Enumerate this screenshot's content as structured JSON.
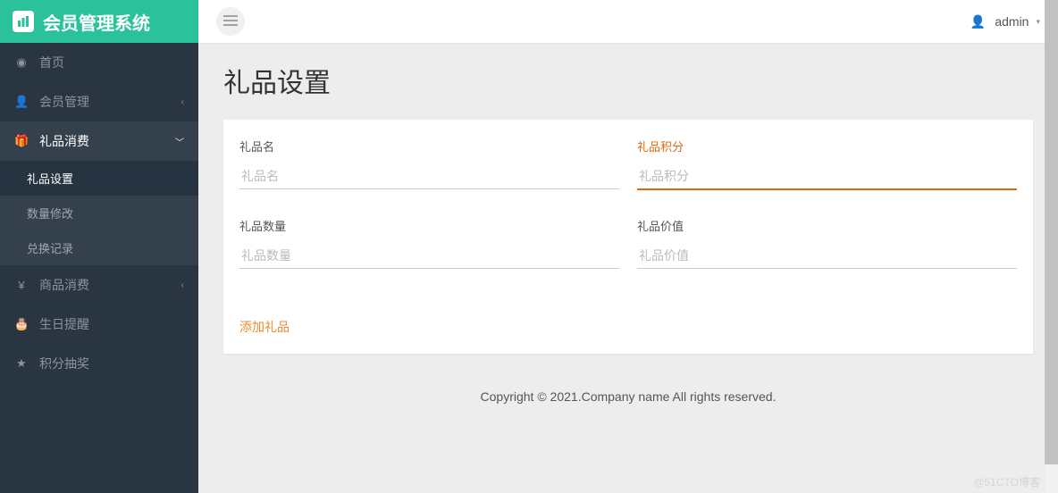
{
  "logo": {
    "title": "会员管理系统"
  },
  "user": {
    "name": "admin"
  },
  "page": {
    "title": "礼品设置"
  },
  "sidebar": {
    "home": "首页",
    "member": "会员管理",
    "gift": {
      "label": "礼品消费",
      "sub": {
        "setting": "礼品设置",
        "qty": "数量修改",
        "record": "兑换记录"
      }
    },
    "product": "商品消费",
    "birthday": "生日提醒",
    "lottery": "积分抽奖"
  },
  "form": {
    "name": {
      "label": "礼品名",
      "placeholder": "礼品名"
    },
    "points": {
      "label": "礼品积分",
      "placeholder": "礼品积分"
    },
    "qty": {
      "label": "礼品数量",
      "placeholder": "礼品数量"
    },
    "value": {
      "label": "礼品价值",
      "placeholder": "礼品价值"
    },
    "add_btn": "添加礼品"
  },
  "footer": "Copyright © 2021.Company name All rights reserved.",
  "watermark": "@51CTO博客"
}
